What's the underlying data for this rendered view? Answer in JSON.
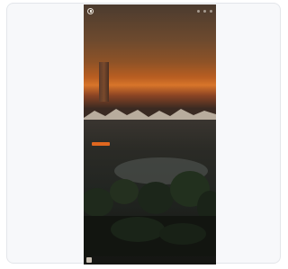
{
  "window": {
    "brand": "",
    "controls": [
      "minimize-icon",
      "maximize-icon",
      "close-icon"
    ]
  },
  "hero": {
    "headline": "",
    "cta_label": ""
  },
  "colors": {
    "accent": "#e0671f",
    "frame_border": "#e3e6ea",
    "frame_bg": "#f7f8fa",
    "sky_glow": "#d8752a"
  },
  "side_icons": [
    "settings-icon",
    "orange-action-icon"
  ]
}
